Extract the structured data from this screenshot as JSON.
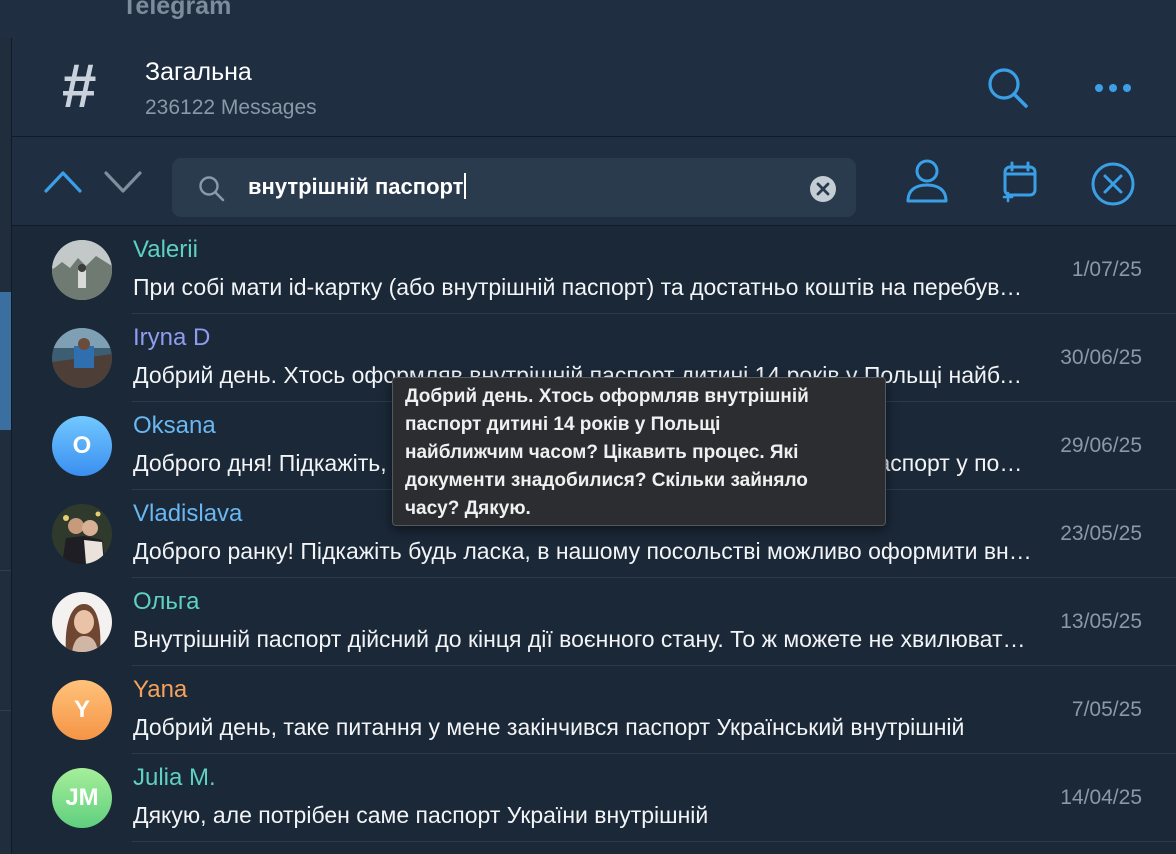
{
  "app": {
    "title": "Telegram"
  },
  "chat": {
    "title": "Загальна",
    "subtitle": "236122 Messages"
  },
  "search": {
    "query": "внутрішній паспорт"
  },
  "colors": {
    "accent": "#3a9fe6",
    "name_teal": "#5ed1c0",
    "name_blue": "#6ab7f2",
    "name_purple": "#8f9df0",
    "name_orange": "#f5a35c"
  },
  "icons": {
    "header": [
      "hash-icon",
      "search-icon",
      "more-icon"
    ],
    "searchbar": [
      "chevron-up-icon",
      "chevron-down-icon",
      "search-icon",
      "clear-icon",
      "user-filter-icon",
      "calendar-icon",
      "close-icon"
    ]
  },
  "results": [
    {
      "name": "Valerii",
      "message": "При собі мати id-картку (або внутрішній паспорт) та достатньо коштів на перебування",
      "date": "1/07/25",
      "avatar_letter": ""
    },
    {
      "name": "Iryna D",
      "message": "Добрий день. Хтось оформляв внутрішній паспорт дитині 14 років у Польщі найближчим часом?",
      "date": "30/06/25",
      "avatar_letter": ""
    },
    {
      "name": "Oksana",
      "message": "Доброго дня! Підкажіть, будь ласка, чи можна оформити внутрішній паспорт у посольстві України",
      "date": "29/06/25",
      "avatar_letter": "O"
    },
    {
      "name": "Vladislava",
      "message": "Доброго ранку! Підкажіть будь ласка, в нашому посольстві можливо оформити внутрішній паспорт",
      "date": "23/05/25",
      "avatar_letter": ""
    },
    {
      "name": "Ольга",
      "message": "Внутрішній паспорт дійсний до кінця дії воєнного стану. То ж можете не хвилюватися",
      "date": "13/05/25",
      "avatar_letter": ""
    },
    {
      "name": "Yana",
      "message": "Добрий день, таке питання у мене закінчився паспорт Український внутрішній",
      "date": "7/05/25",
      "avatar_letter": "Y"
    },
    {
      "name": "Julia M.",
      "message": "Дякую, але потрібен саме паспорт України внутрішній",
      "date": "14/04/25",
      "avatar_letter": "JM"
    }
  ],
  "tooltip": {
    "lines": [
      "Добрий день. Хтось оформляв внутрішній",
      "паспорт дитині 14 років у Польщі",
      "найближчим часом? Цікавить процес. Які",
      "документи знадобилися? Скільки зайняло",
      "часу? Дякую."
    ]
  }
}
